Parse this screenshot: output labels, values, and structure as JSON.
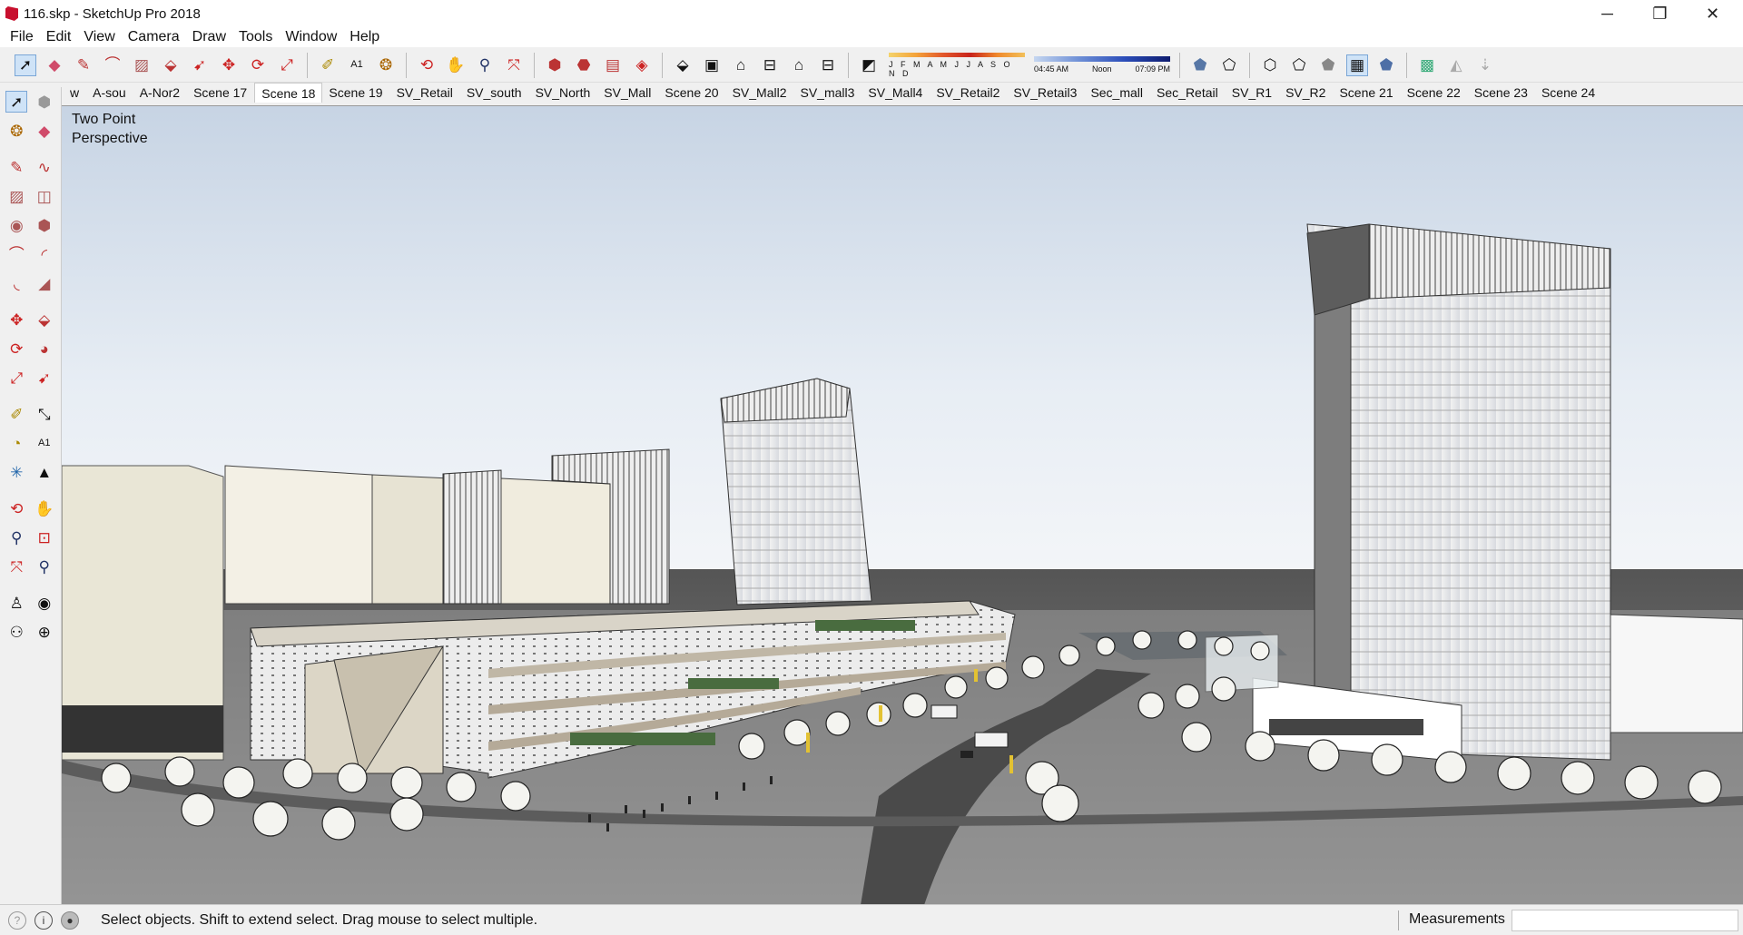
{
  "window": {
    "title": "116.skp - SketchUp Pro 2018",
    "minimize_glyph": "─",
    "restore_glyph": "❐",
    "close_glyph": "✕"
  },
  "menu": [
    "File",
    "Edit",
    "View",
    "Camera",
    "Draw",
    "Tools",
    "Window",
    "Help"
  ],
  "toolbar": {
    "shadow_months": "J F M A M J J A S O N D",
    "time_start": "04:45 AM",
    "time_noon": "Noon",
    "time_end": "07:09 PM"
  },
  "scene_tabs": [
    {
      "label": "w"
    },
    {
      "label": "A-sou"
    },
    {
      "label": "A-Nor2"
    },
    {
      "label": "Scene 17"
    },
    {
      "label": "Scene 18",
      "active": true
    },
    {
      "label": "Scene 19"
    },
    {
      "label": "SV_Retail"
    },
    {
      "label": "SV_south"
    },
    {
      "label": "SV_North"
    },
    {
      "label": "SV_Mall"
    },
    {
      "label": "Scene 20"
    },
    {
      "label": "SV_Mall2"
    },
    {
      "label": "SV_mall3"
    },
    {
      "label": "SV_Mall4"
    },
    {
      "label": "SV_Retail2"
    },
    {
      "label": "SV_Retail3"
    },
    {
      "label": "Sec_mall"
    },
    {
      "label": "Sec_Retail"
    },
    {
      "label": "SV_R1"
    },
    {
      "label": "SV_R2"
    },
    {
      "label": "Scene 21"
    },
    {
      "label": "Scene 22"
    },
    {
      "label": "Scene 23"
    },
    {
      "label": "Scene 24"
    }
  ],
  "viewport": {
    "camera_label_line1": "Two Point",
    "camera_label_line2": "Perspective"
  },
  "status": {
    "hint": "Select objects. Shift to extend select. Drag mouse to select multiple.",
    "measurements_label": "Measurements",
    "measurements_value": ""
  },
  "colors": {
    "sky_top": "#c7d4e4",
    "ground": "#6e6e6e",
    "accent_selected": "#cfe3f7",
    "logo": "#c8102e"
  }
}
